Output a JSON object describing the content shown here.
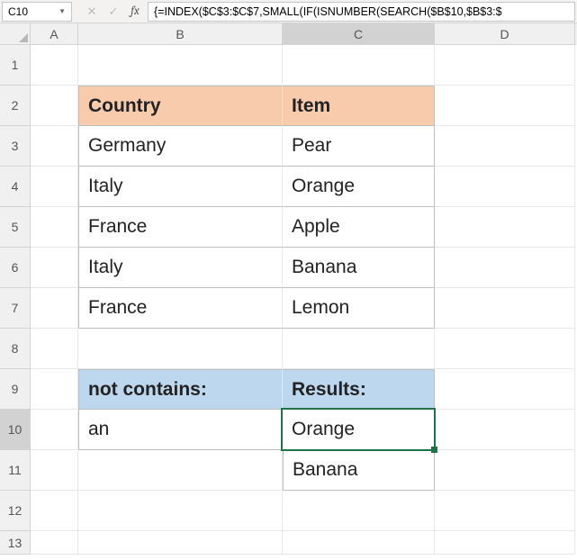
{
  "namebox": {
    "cellref": "C10"
  },
  "formulabar": {
    "fx_label": "fx",
    "formula": "{=INDEX($C$3:$C$7,SMALL(IF(ISNUMBER(SEARCH($B$10,$B$3:$"
  },
  "columns": {
    "A": "A",
    "B": "B",
    "C": "C",
    "D": "D"
  },
  "rows": {
    "r1": "1",
    "r2": "2",
    "r3": "3",
    "r4": "4",
    "r5": "5",
    "r6": "6",
    "r7": "7",
    "r8": "8",
    "r9": "9",
    "r10": "10",
    "r11": "11",
    "r12": "12",
    "r13": "13"
  },
  "table1": {
    "headers": {
      "country": "Country",
      "item": "Item"
    },
    "data": [
      {
        "country": "Germany",
        "item": "Pear"
      },
      {
        "country": "Italy",
        "item": "Orange"
      },
      {
        "country": "France",
        "item": "Apple"
      },
      {
        "country": "Italy",
        "item": "Banana"
      },
      {
        "country": "France",
        "item": "Lemon"
      }
    ]
  },
  "table2": {
    "headers": {
      "notcontains": "not contains:",
      "results": "Results:"
    },
    "search": "an",
    "results": [
      "Orange",
      "Banana"
    ]
  },
  "icons": {
    "cancel": "✕",
    "enter": "✓",
    "dropdown": "▼"
  }
}
